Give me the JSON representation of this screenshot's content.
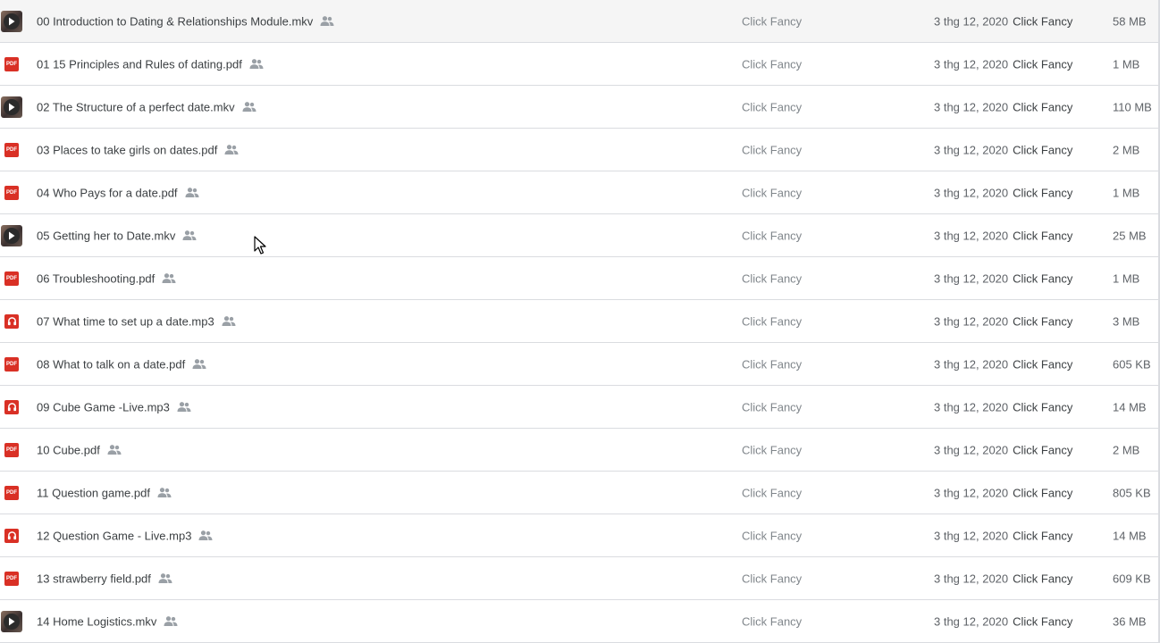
{
  "files": [
    {
      "type": "video",
      "name": "00 Introduction to Dating & Relationships Module.mkv",
      "owner": "Click Fancy",
      "modified": "3 thg 12, 2020",
      "modified_by": "Click Fancy",
      "size": "58 MB"
    },
    {
      "type": "pdf",
      "name": "01 15 Principles and Rules of dating.pdf",
      "owner": "Click Fancy",
      "modified": "3 thg 12, 2020",
      "modified_by": "Click Fancy",
      "size": "1 MB"
    },
    {
      "type": "video",
      "name": "02 The Structure of a perfect date.mkv",
      "owner": "Click Fancy",
      "modified": "3 thg 12, 2020",
      "modified_by": "Click Fancy",
      "size": "110 MB"
    },
    {
      "type": "pdf",
      "name": "03 Places to take girls on dates.pdf",
      "owner": "Click Fancy",
      "modified": "3 thg 12, 2020",
      "modified_by": "Click Fancy",
      "size": "2 MB"
    },
    {
      "type": "pdf",
      "name": "04 Who Pays for a date.pdf",
      "owner": "Click Fancy",
      "modified": "3 thg 12, 2020",
      "modified_by": "Click Fancy",
      "size": "1 MB"
    },
    {
      "type": "video",
      "name": "05 Getting her to Date.mkv",
      "owner": "Click Fancy",
      "modified": "3 thg 12, 2020",
      "modified_by": "Click Fancy",
      "size": "25 MB"
    },
    {
      "type": "pdf",
      "name": "06 Troubleshooting.pdf",
      "owner": "Click Fancy",
      "modified": "3 thg 12, 2020",
      "modified_by": "Click Fancy",
      "size": "1 MB"
    },
    {
      "type": "audio",
      "name": "07 What time to set up a date.mp3",
      "owner": "Click Fancy",
      "modified": "3 thg 12, 2020",
      "modified_by": "Click Fancy",
      "size": "3 MB"
    },
    {
      "type": "pdf",
      "name": "08 What to talk on a date.pdf",
      "owner": "Click Fancy",
      "modified": "3 thg 12, 2020",
      "modified_by": "Click Fancy",
      "size": "605 KB"
    },
    {
      "type": "audio",
      "name": "09 Cube Game -Live.mp3",
      "owner": "Click Fancy",
      "modified": "3 thg 12, 2020",
      "modified_by": "Click Fancy",
      "size": "14 MB"
    },
    {
      "type": "pdf",
      "name": "10 Cube.pdf",
      "owner": "Click Fancy",
      "modified": "3 thg 12, 2020",
      "modified_by": "Click Fancy",
      "size": "2 MB"
    },
    {
      "type": "pdf",
      "name": "11 Question game.pdf",
      "owner": "Click Fancy",
      "modified": "3 thg 12, 2020",
      "modified_by": "Click Fancy",
      "size": "805 KB"
    },
    {
      "type": "audio",
      "name": "12 Question Game - Live.mp3",
      "owner": "Click Fancy",
      "modified": "3 thg 12, 2020",
      "modified_by": "Click Fancy",
      "size": "14 MB"
    },
    {
      "type": "pdf",
      "name": "13 strawberry field.pdf",
      "owner": "Click Fancy",
      "modified": "3 thg 12, 2020",
      "modified_by": "Click Fancy",
      "size": "609 KB"
    },
    {
      "type": "video",
      "name": "14 Home Logistics.mkv",
      "owner": "Click Fancy",
      "modified": "3 thg 12, 2020",
      "modified_by": "Click Fancy",
      "size": "36 MB"
    }
  ],
  "pdf_icon_label": "PDF",
  "icons": {
    "shared": "people-icon",
    "video": "video-play-icon",
    "pdf": "pdf-icon",
    "audio": "headphones-icon"
  },
  "colors": {
    "pdf_red": "#d93025",
    "divider": "#dadce0",
    "text": "#3c4043",
    "muted": "#80868b"
  }
}
